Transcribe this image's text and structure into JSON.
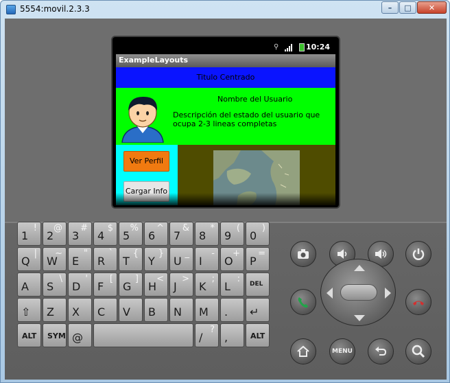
{
  "window": {
    "title": "5554:movil.2.3.3",
    "buttons": {
      "minimize": "–",
      "maximize": "□",
      "close": "✕"
    }
  },
  "device": {
    "status_time": "10:24",
    "app_title": "ExampleLayouts",
    "title_row": "Titulo Centrado",
    "user_name": "Nombre del Usuario",
    "user_description": "Descripción del estado del usuario que ocupa 2-3 lineas completas",
    "buttons": {
      "profile": "Ver Perfil",
      "load": "Cargar Info"
    }
  },
  "keyboard": {
    "row1": [
      {
        "k": "1",
        "a": "!"
      },
      {
        "k": "2",
        "a": "@"
      },
      {
        "k": "3",
        "a": "#"
      },
      {
        "k": "4",
        "a": "$"
      },
      {
        "k": "5",
        "a": "%"
      },
      {
        "k": "6",
        "a": "^"
      },
      {
        "k": "7",
        "a": "&"
      },
      {
        "k": "8",
        "a": "*"
      },
      {
        "k": "9",
        "a": "("
      },
      {
        "k": "0",
        "a": ")"
      }
    ],
    "row2": [
      {
        "k": "Q",
        "a": "|"
      },
      {
        "k": "W",
        "a": "~"
      },
      {
        "k": "E",
        "a": "\""
      },
      {
        "k": "R",
        "a": "`"
      },
      {
        "k": "T",
        "a": "{"
      },
      {
        "k": "Y",
        "a": "}"
      },
      {
        "k": "U",
        "a": "_"
      },
      {
        "k": "I",
        "a": "-"
      },
      {
        "k": "O",
        "a": "+"
      },
      {
        "k": "P",
        "a": "="
      }
    ],
    "row3": [
      {
        "k": "A",
        "a": ""
      },
      {
        "k": "S",
        "a": "\\"
      },
      {
        "k": "D",
        "a": "'"
      },
      {
        "k": "F",
        "a": "["
      },
      {
        "k": "G",
        "a": "]"
      },
      {
        "k": "H",
        "a": "<"
      },
      {
        "k": "J",
        "a": ">"
      },
      {
        "k": "K",
        "a": ";"
      },
      {
        "k": "L",
        "a": ":"
      },
      {
        "k": "DEL",
        "a": ""
      }
    ],
    "row4": [
      {
        "k": "⇧",
        "a": ""
      },
      {
        "k": "Z",
        "a": ""
      },
      {
        "k": "X",
        "a": ""
      },
      {
        "k": "C",
        "a": ""
      },
      {
        "k": "V",
        "a": ""
      },
      {
        "k": "B",
        "a": ""
      },
      {
        "k": "N",
        "a": ""
      },
      {
        "k": "M",
        "a": ""
      },
      {
        "k": ".",
        "a": ""
      },
      {
        "k": "↵",
        "a": ""
      }
    ],
    "row5": {
      "alt_left": "ALT",
      "sym": "SYM",
      "at": "@",
      "slash": "/",
      "question": "?",
      "comma": ",",
      "alt_right": "ALT"
    }
  },
  "hardware_buttons": {
    "menu": "MENU"
  }
}
